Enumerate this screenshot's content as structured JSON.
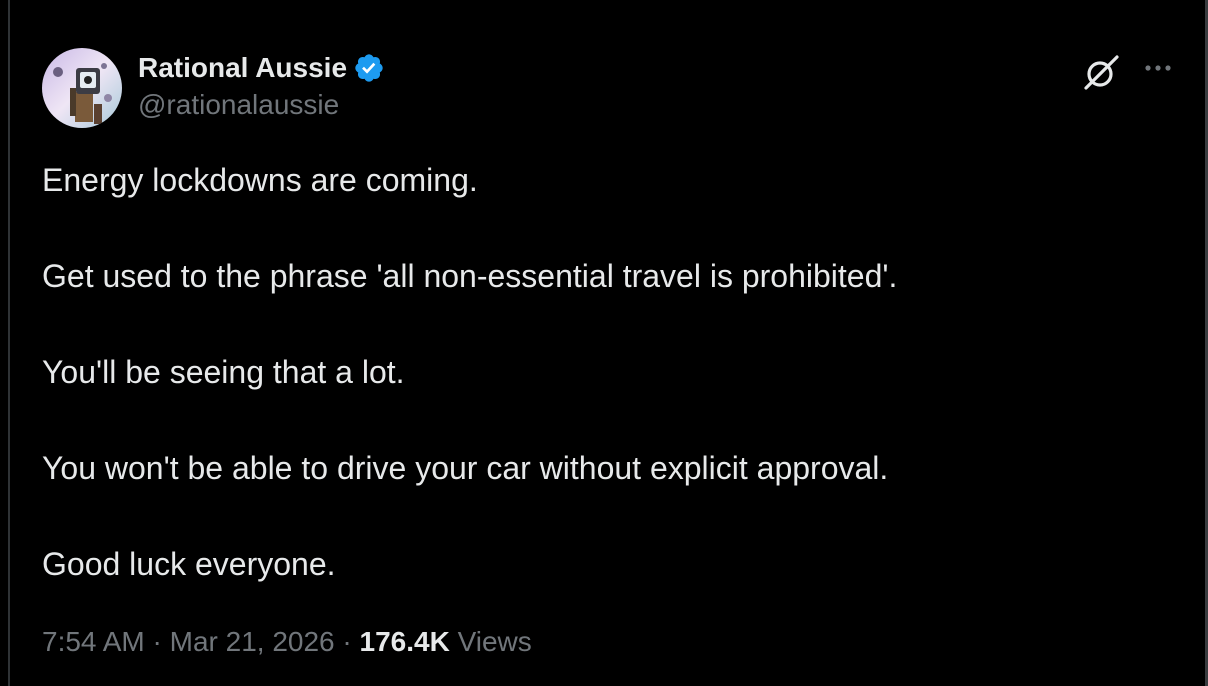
{
  "author": {
    "display_name": "Rational Aussie",
    "handle": "@rationalaussie",
    "verified": true
  },
  "tweet": {
    "paragraphs": [
      "Energy lockdowns are coming.",
      "Get used to the phrase 'all non-essential travel is prohibited'.",
      "You'll be seeing that a lot.",
      "You won't be able to drive your car without explicit approval.",
      "Good luck everyone."
    ]
  },
  "meta": {
    "time": "7:54 AM",
    "separator": "·",
    "date": "Mar 21, 2026",
    "views_count": "176.4K",
    "views_label": "Views"
  },
  "icons": {
    "verified": "verified-badge-icon",
    "grok": "grok-icon",
    "more": "more-options-icon"
  },
  "colors": {
    "background": "#000000",
    "text_primary": "#e7e9ea",
    "text_secondary": "#71767b",
    "verified_blue": "#1d9bf0"
  }
}
